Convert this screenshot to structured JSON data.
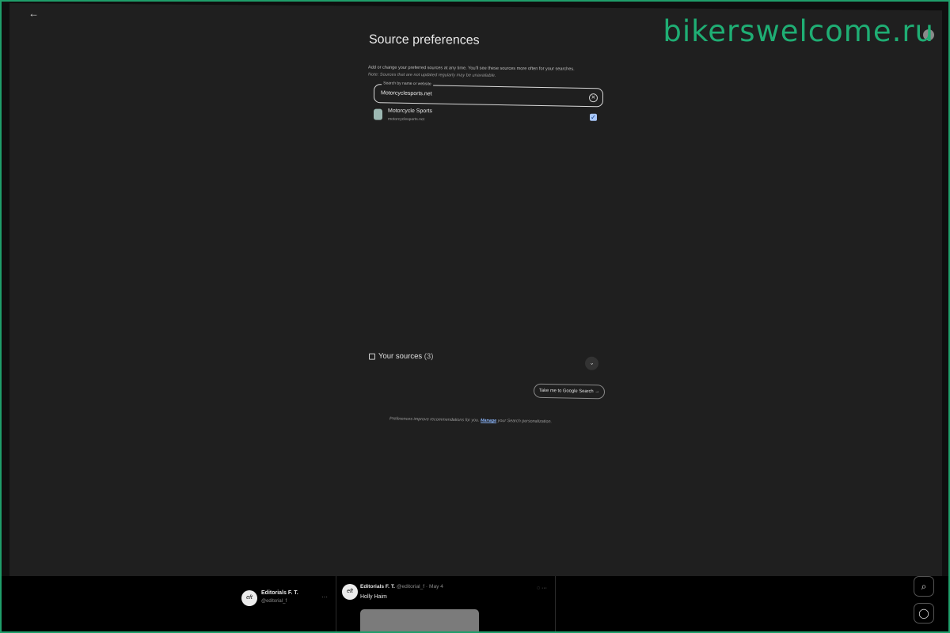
{
  "watermark": "bikerswelcome.ru",
  "header": {
    "back_glyph": "←",
    "title": "Source preferences"
  },
  "intro": {
    "description": "Add or change your preferred sources at any time. You'll see these sources more often for your searches.",
    "note": "Note: Sources that are not updated regularly may be unavailable."
  },
  "search": {
    "label": "Search by name or website",
    "value": "Motorcyclesports.net",
    "clear_glyph": "✕"
  },
  "results": [
    {
      "name": "Motorcycle Sports",
      "url": "motorcyclesports.net",
      "checked": true,
      "check_glyph": "✓"
    }
  ],
  "your_sources": {
    "label": "Your sources",
    "count": "(3)",
    "chevron_glyph": "⌄"
  },
  "actions": {
    "take_me_label": "Take me to Google Search →"
  },
  "footer": {
    "note_before": "Preferences improve recommendations for you.",
    "link": "Manage",
    "note_after": "your Search personalization."
  },
  "social": {
    "profile": {
      "avatar_text": "eft",
      "name": "Editorials F. T.",
      "handle": "@editorial_f",
      "more_glyph": "···"
    },
    "post": {
      "avatar_text": "eft",
      "name": "Editorials F. T.",
      "meta": "@editorial_f · May 4",
      "text": "Holly Haim",
      "icons": "◌ ···"
    },
    "side_buttons": [
      "⌕",
      "◯"
    ]
  },
  "icons": {
    "back": "back-arrow-icon",
    "clear": "close-circle-icon",
    "checkbox": "checkbox-checked-icon",
    "your_sources": "bookmark-icon",
    "chevron": "chevron-down-icon"
  },
  "colors": {
    "watermark": "#1fae74",
    "accent": "#a8c7fa",
    "link": "#8ab4f8",
    "page_bg": "#1f1f1f"
  }
}
